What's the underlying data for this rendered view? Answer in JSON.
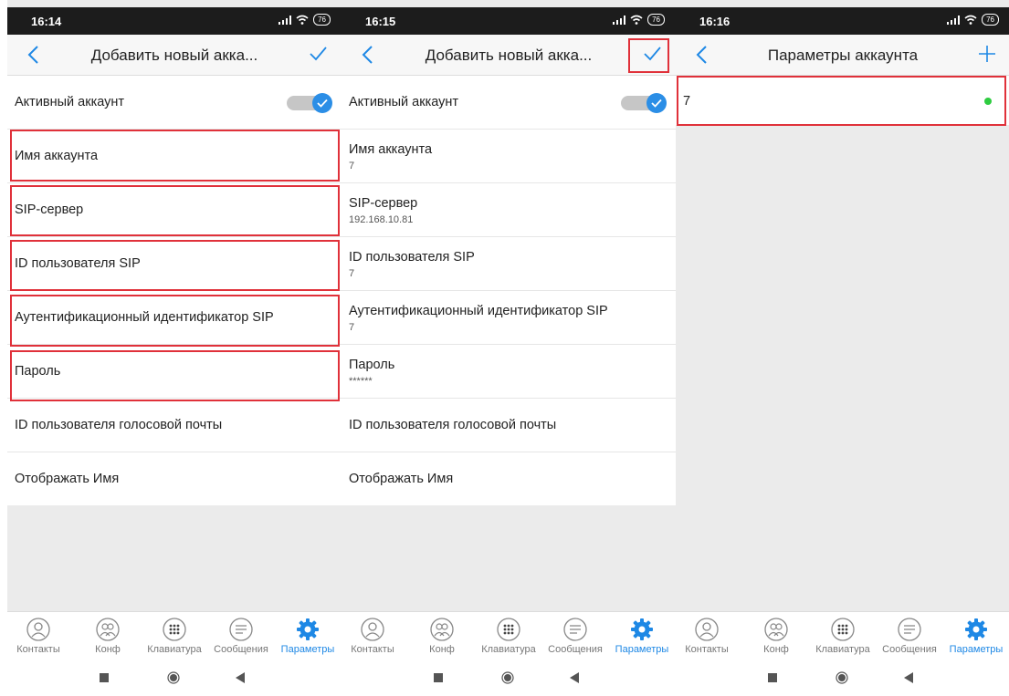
{
  "colors": {
    "accent": "#1e88e5",
    "highlight": "#e0313a",
    "online": "#2ecc40"
  },
  "battery": "76",
  "screens": [
    {
      "time": "16:14",
      "title": "Добавить новый акка...",
      "rows": [
        {
          "label": "Активный аккаунт",
          "value": ""
        },
        {
          "label": "Имя аккаунта",
          "value": ""
        },
        {
          "label": "SIP-сервер",
          "value": ""
        },
        {
          "label": "ID пользователя SIP",
          "value": ""
        },
        {
          "label": "Аутентификационный идентификатор SIP",
          "value": ""
        },
        {
          "label": "Пароль",
          "value": ""
        },
        {
          "label": "ID пользователя голосовой почты",
          "value": ""
        },
        {
          "label": "Отображать Имя",
          "value": ""
        }
      ]
    },
    {
      "time": "16:15",
      "title": "Добавить новый акка...",
      "rows": [
        {
          "label": "Активный аккаунт",
          "value": ""
        },
        {
          "label": "Имя аккаунта",
          "value": "7"
        },
        {
          "label": "SIP-сервер",
          "value": "192.168.10.81"
        },
        {
          "label": "ID пользователя SIP",
          "value": "7"
        },
        {
          "label": "Аутентификационный идентификатор SIP",
          "value": "7"
        },
        {
          "label": "Пароль",
          "value": "******"
        },
        {
          "label": "ID пользователя голосовой почты",
          "value": ""
        },
        {
          "label": "Отображать Имя",
          "value": ""
        }
      ]
    },
    {
      "time": "16:16",
      "title": "Параметры аккаунта",
      "accounts": [
        {
          "label": "7",
          "status": "online"
        }
      ]
    }
  ],
  "tabs": [
    {
      "label": "Контакты",
      "icon": "contacts-icon"
    },
    {
      "label": "Конф",
      "icon": "conference-icon"
    },
    {
      "label": "Клавиатура",
      "icon": "keypad-icon"
    },
    {
      "label": "Сообщения",
      "icon": "messages-icon"
    },
    {
      "label": "Параметры",
      "icon": "settings-gear-icon",
      "active": true
    }
  ]
}
